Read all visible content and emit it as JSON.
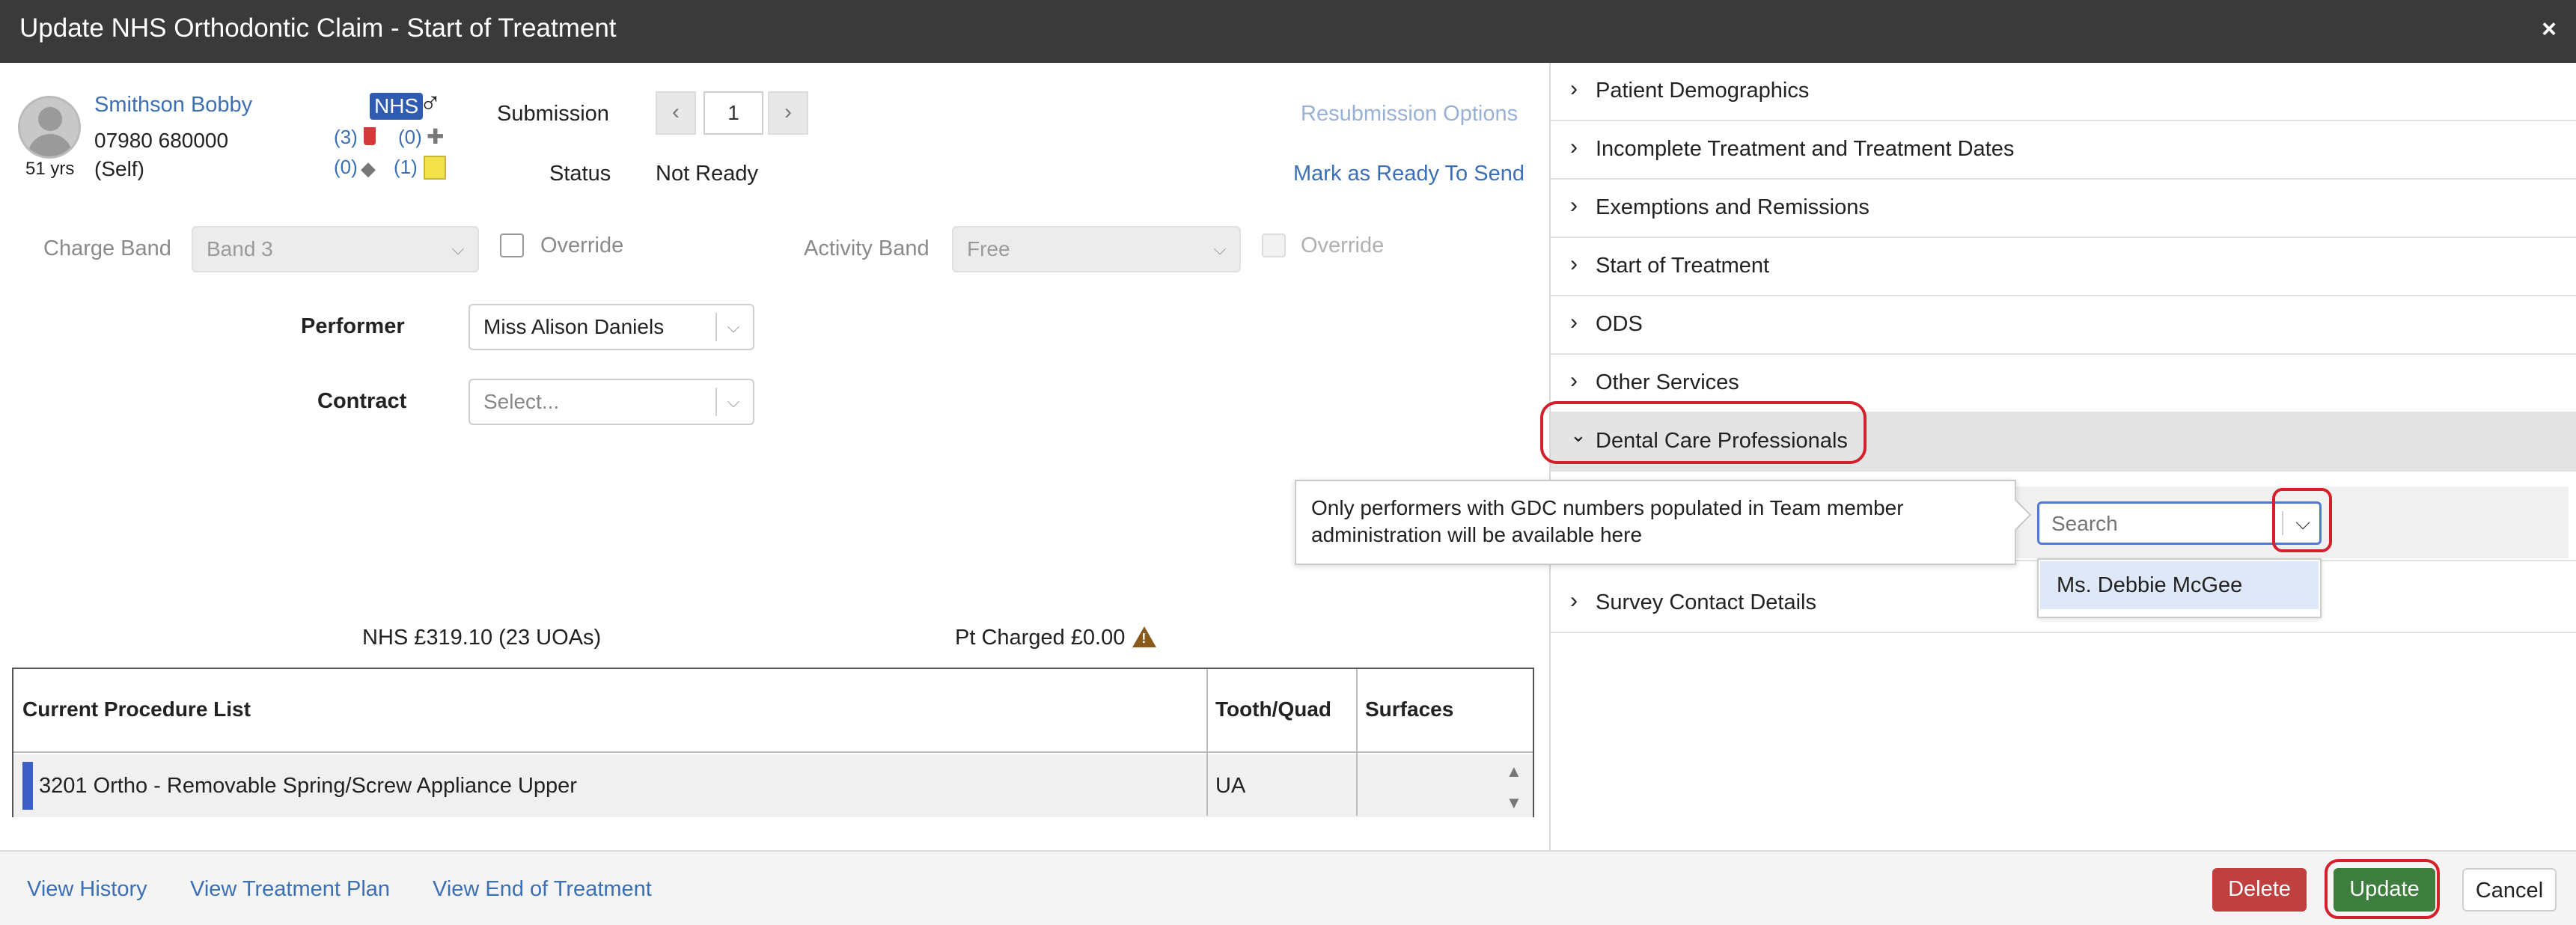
{
  "window": {
    "title": "Update NHS Orthodontic Claim - Start of Treatment",
    "close_icon": "×"
  },
  "patient": {
    "name": "Smithson Bobby",
    "phone": "07980 680000",
    "relation": "(Self)",
    "age": "51 yrs",
    "nhs_badge": "NHS",
    "gender_symbol": "♂",
    "counts": {
      "lab": "(3)",
      "medical": "(0)",
      "tags": "(0)",
      "notes": "(1)"
    }
  },
  "submission": {
    "label": "Submission",
    "prev_icon": "‹",
    "next_icon": "›",
    "value": "1",
    "status_label": "Status",
    "status_value": "Not Ready",
    "resubmission_link": "Resubmission Options",
    "mark_ready_link": "Mark as Ready To Send"
  },
  "bands": {
    "charge_label": "Charge Band",
    "charge_value": "Band 3",
    "override_label": "Override",
    "activity_label": "Activity Band",
    "activity_value": "Free"
  },
  "performer": {
    "label": "Performer",
    "value": "Miss Alison Daniels"
  },
  "contract": {
    "label": "Contract",
    "placeholder": "Select..."
  },
  "totals": {
    "nhs": "NHS £319.10 (23 UOAs)",
    "pt_charged": "Pt Charged £0.00"
  },
  "procedures": {
    "headers": [
      "Current Procedure List",
      "Tooth/Quad",
      "Surfaces"
    ],
    "rows": [
      {
        "name": "3201 Ortho - Removable Spring/Screw Appliance Upper",
        "tooth": "UA",
        "surfaces": ""
      }
    ]
  },
  "accordion": [
    {
      "label": "Patient Demographics"
    },
    {
      "label": "Incomplete Treatment and Treatment Dates"
    },
    {
      "label": "Exemptions and Remissions"
    },
    {
      "label": "Start of Treatment"
    },
    {
      "label": "ODS"
    },
    {
      "label": "Other Services"
    },
    {
      "label": "Dental Care Professionals"
    },
    {
      "label": "Survey Contact Details"
    }
  ],
  "dcp": {
    "tooltip": "Only performers with GDC numbers populated in Team member administration will be available here",
    "search_placeholder": "Search",
    "options": [
      "Ms. Debbie McGee"
    ]
  },
  "footer": {
    "view_history": "View History",
    "view_treatment_plan": "View Treatment Plan",
    "view_end_of_treatment": "View End of Treatment",
    "delete": "Delete",
    "update": "Update",
    "cancel": "Cancel"
  },
  "colors": {
    "annotation": "#d3202a",
    "link": "#3b6fb6",
    "update": "#3d7d3d",
    "delete": "#c0403f"
  }
}
